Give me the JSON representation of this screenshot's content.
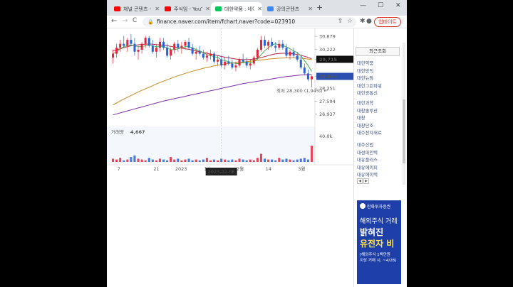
{
  "tabs": [
    {
      "title": "채널 콘텐츠 - ",
      "color": "#ff0000",
      "active": false
    },
    {
      "title": "주식임 - YouTu",
      "color": "#ff0000",
      "active": false
    },
    {
      "title": "대한약품 : 네이",
      "color": "#03c75a",
      "active": true
    },
    {
      "title": "강의콘텐츠",
      "color": "#4285f4",
      "active": false
    }
  ],
  "new_tab": "+",
  "window_controls": {
    "minimize": "—",
    "maximize": "☐",
    "close": "✕"
  },
  "toolbar": {
    "url": "finance.naver.com/item/fchart.naver?code=023910",
    "update_label": "업데이트",
    "back": "←",
    "forward": "→",
    "reload": "C"
  },
  "chart_data": {
    "type": "candlestick",
    "y_ticks": [
      30879,
      30222,
      29715,
      28850,
      28251,
      27594,
      26937
    ],
    "price_tag_upper": "29,715",
    "price_tag_lower": "28,850",
    "low_annotation": "최저 28,300 (1.94%) ←",
    "volume_label": "거래량",
    "volume_value": "4,667",
    "volume_axis_max": "40.0k",
    "x_ticks": [
      "7",
      "21",
      "2023",
      "14",
      "2월",
      "14",
      "3월"
    ],
    "crosshair_date": "2023-02-08",
    "ylim": [
      26600,
      31100
    ],
    "candles": [
      [
        29800,
        30200,
        29500,
        30000
      ],
      [
        30000,
        30500,
        29800,
        30300
      ],
      [
        30300,
        30700,
        30100,
        30500
      ],
      [
        30500,
        30900,
        30300,
        30400
      ],
      [
        30400,
        30800,
        30100,
        30700
      ],
      [
        30700,
        31000,
        30400,
        30500
      ],
      [
        30500,
        30800,
        29900,
        30100
      ],
      [
        30100,
        30400,
        29700,
        30200
      ],
      [
        30200,
        30600,
        30000,
        30500
      ],
      [
        30500,
        30900,
        30300,
        30800
      ],
      [
        30800,
        30900,
        30300,
        30400
      ],
      [
        30400,
        30700,
        30000,
        30100
      ],
      [
        30100,
        30500,
        29800,
        30300
      ],
      [
        30300,
        30800,
        30100,
        30600
      ],
      [
        30600,
        30800,
        30200,
        30300
      ],
      [
        30300,
        30500,
        29800,
        29900
      ],
      [
        29900,
        30300,
        29700,
        30200
      ],
      [
        30200,
        30600,
        30000,
        30500
      ],
      [
        30500,
        30700,
        30100,
        30300
      ],
      [
        30300,
        30600,
        30000,
        30400
      ],
      [
        30400,
        30700,
        30200,
        30600
      ],
      [
        30600,
        30800,
        30200,
        30300
      ],
      [
        30300,
        30500,
        29900,
        30000
      ],
      [
        30000,
        30300,
        29700,
        30100
      ],
      [
        30100,
        30400,
        29900,
        30000
      ],
      [
        30000,
        30200,
        29700,
        29800
      ],
      [
        29800,
        30100,
        29600,
        29900
      ],
      [
        29900,
        30200,
        29700,
        30000
      ],
      [
        30000,
        30100,
        29500,
        29600
      ],
      [
        29600,
        29900,
        29400,
        29700
      ],
      [
        29700,
        29900,
        29300,
        29400
      ],
      [
        29400,
        29800,
        29200,
        29600
      ],
      [
        29600,
        29900,
        29400,
        29500
      ],
      [
        29500,
        29700,
        29200,
        29300
      ],
      [
        29300,
        29600,
        29100,
        29400
      ],
      [
        29400,
        29800,
        29300,
        29700
      ],
      [
        29700,
        30000,
        29500,
        29600
      ],
      [
        29600,
        29800,
        29300,
        29400
      ],
      [
        29400,
        29700,
        29200,
        29500
      ],
      [
        29500,
        29900,
        29400,
        29800
      ],
      [
        29800,
        30300,
        29700,
        30200
      ],
      [
        30200,
        30900,
        30100,
        30700
      ],
      [
        30700,
        30900,
        30300,
        30400
      ],
      [
        30400,
        30700,
        30200,
        30600
      ],
      [
        30600,
        30800,
        30300,
        30400
      ],
      [
        30400,
        30600,
        30100,
        30300
      ],
      [
        30300,
        30700,
        30200,
        30500
      ],
      [
        30500,
        30700,
        30200,
        30300
      ],
      [
        30300,
        30500,
        29800,
        29900
      ],
      [
        29900,
        30200,
        29700,
        30100
      ],
      [
        30100,
        30300,
        29800,
        29900
      ],
      [
        29900,
        30100,
        29600,
        29700
      ],
      [
        29700,
        29900,
        29200,
        29300
      ],
      [
        29300,
        29500,
        28900,
        29000
      ],
      [
        29000,
        29200,
        28600,
        28700
      ],
      [
        28700,
        28900,
        28300,
        28850
      ]
    ],
    "ma_short": [
      30000,
      30100,
      30250,
      30350,
      30400,
      30450,
      30400,
      30350,
      30350,
      30400,
      30450,
      30400,
      30350,
      30350,
      30350,
      30300,
      30200,
      30200,
      30250,
      30300,
      30350,
      30350,
      30300,
      30200,
      30150,
      30050,
      29950,
      29900,
      29850,
      29800,
      29700,
      29650,
      29600,
      29550,
      29500,
      29500,
      29550,
      29550,
      29550,
      29600,
      29750,
      29950,
      30150,
      30300,
      30450,
      30500,
      30450,
      30400,
      30350,
      30250,
      30150,
      30050,
      29900,
      29650,
      29400,
      29100
    ],
    "ma_mid": [
      30150,
      30200,
      30250,
      30300,
      30350,
      30400,
      30430,
      30450,
      30470,
      30480,
      30490,
      30480,
      30460,
      30440,
      30420,
      30400,
      30370,
      30340,
      30310,
      30280,
      30250,
      30220,
      30180,
      30140,
      30100,
      30060,
      30020,
      29980,
      29940,
      29900,
      29860,
      29820,
      29790,
      29760,
      29730,
      29710,
      29700,
      29700,
      29710,
      29730,
      29760,
      29800,
      29850,
      29900,
      29950,
      29990,
      30010,
      30020,
      30020,
      30010,
      29990,
      29960,
      29920,
      29870,
      29810,
      29740
    ],
    "ma_long": [
      27400,
      27500,
      27600,
      27700,
      27790,
      27880,
      27970,
      28060,
      28140,
      28220,
      28300,
      28380,
      28460,
      28540,
      28610,
      28680,
      28750,
      28820,
      28880,
      28940,
      29000,
      29060,
      29110,
      29160,
      29210,
      29260,
      29300,
      29340,
      29380,
      29410,
      29440,
      29470,
      29500,
      29520,
      29540,
      29560,
      29580,
      29600,
      29620,
      29640,
      29660,
      29680,
      29700,
      29720,
      29740,
      29760,
      29770,
      29780,
      29790,
      29790,
      29790,
      29780,
      29770,
      29750,
      29730,
      29700
    ],
    "ma_vlong": [
      26900,
      26950,
      27000,
      27050,
      27100,
      27150,
      27200,
      27250,
      27300,
      27350,
      27400,
      27450,
      27500,
      27550,
      27600,
      27640,
      27680,
      27720,
      27760,
      27800,
      27840,
      27880,
      27920,
      27960,
      28000,
      28040,
      28080,
      28120,
      28160,
      28200,
      28240,
      28280,
      28320,
      28360,
      28400,
      28440,
      28480,
      28510,
      28540,
      28570,
      28600,
      28630,
      28660,
      28690,
      28720,
      28750,
      28780,
      28810,
      28840,
      28860,
      28880,
      28900,
      28920,
      28930,
      28940,
      28950
    ],
    "volumes": [
      4,
      3,
      5,
      2,
      3,
      6,
      8,
      4,
      3,
      2,
      5,
      3,
      2,
      4,
      3,
      2,
      6,
      3,
      4,
      2,
      3,
      4,
      2,
      3,
      2,
      3,
      5,
      2,
      3,
      2,
      4,
      3,
      2,
      3,
      2,
      4,
      3,
      2,
      3,
      2,
      5,
      10,
      4,
      3,
      3,
      2,
      5,
      3,
      4,
      3,
      2,
      3,
      4,
      5,
      3,
      20
    ],
    "volume_max": 40
  },
  "panel": {
    "title": "최근조회",
    "groups": [
      [
        "대한약품",
        "대한방직",
        "대한뉴팜",
        "대한그린파워",
        "대한광통신"
      ],
      [
        "대한과학",
        "대창솔루션",
        "대창",
        "대창단조",
        "대주전자재료"
      ],
      [
        "대주산업",
        "대성파인텍",
        "대유플러스",
        "대유에이피",
        "대유에이텍"
      ]
    ],
    "prev": "◀",
    "next": "▶",
    "ad": {
      "brand": "한화투자증권",
      "line1": "해외주식 거래",
      "line2": "밝혀진",
      "line3": "유전자 비",
      "line4": "[해외주식 1백만원",
      "line5": "이상 거래 시, ~4/28]"
    }
  }
}
